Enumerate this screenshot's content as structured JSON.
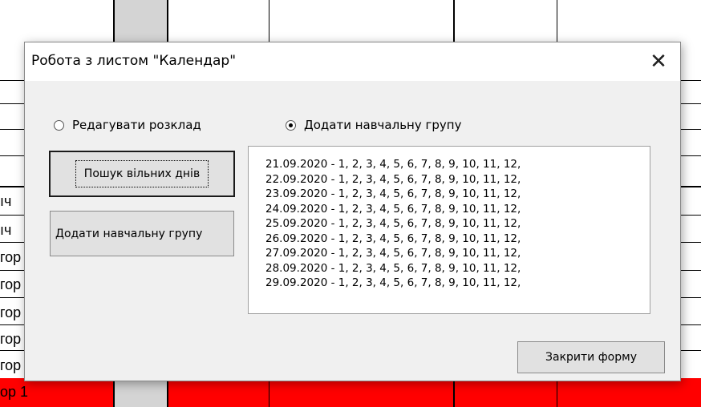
{
  "sheet": {
    "row_fragments": [
      "ıч",
      "ıч",
      "гор",
      "гор",
      "гор",
      "гор",
      "гор"
    ],
    "last_row_text": "ор 1",
    "highlight_color": "#ff0000"
  },
  "dialog": {
    "title": "Робота з листом \"Календар\"",
    "close_icon": "close-icon",
    "radio_edit": {
      "label": "Редагувати розклад",
      "checked": false
    },
    "radio_add": {
      "label": "Додати навчальну групу",
      "checked": true
    },
    "buttons": {
      "search_free_days": "Пошук вільних днів",
      "add_group": "Додати навчальну групу",
      "close_form": "Закрити форму"
    },
    "list_items": [
      "21.09.2020 - 1, 2, 3, 4, 5, 6, 7, 8, 9, 10, 11, 12,",
      "22.09.2020 - 1, 2, 3, 4, 5, 6, 7, 8, 9, 10, 11, 12,",
      "23.09.2020 - 1, 2, 3, 4, 5, 6, 7, 8, 9, 10, 11, 12,",
      "24.09.2020 - 1, 2, 3, 4, 5, 6, 7, 8, 9, 10, 11, 12,",
      "25.09.2020 - 1, 2, 3, 4, 5, 6, 7, 8, 9, 10, 11, 12,",
      "26.09.2020 - 1, 2, 3, 4, 5, 6, 7, 8, 9, 10, 11, 12,",
      "27.09.2020 - 1, 2, 3, 4, 5, 6, 7, 8, 9, 10, 11, 12,",
      "28.09.2020 - 1, 2, 3, 4, 5, 6, 7, 8, 9, 10, 11, 12,",
      "29.09.2020 - 1, 2, 3, 4, 5, 6, 7, 8, 9, 10, 11, 12,"
    ]
  }
}
